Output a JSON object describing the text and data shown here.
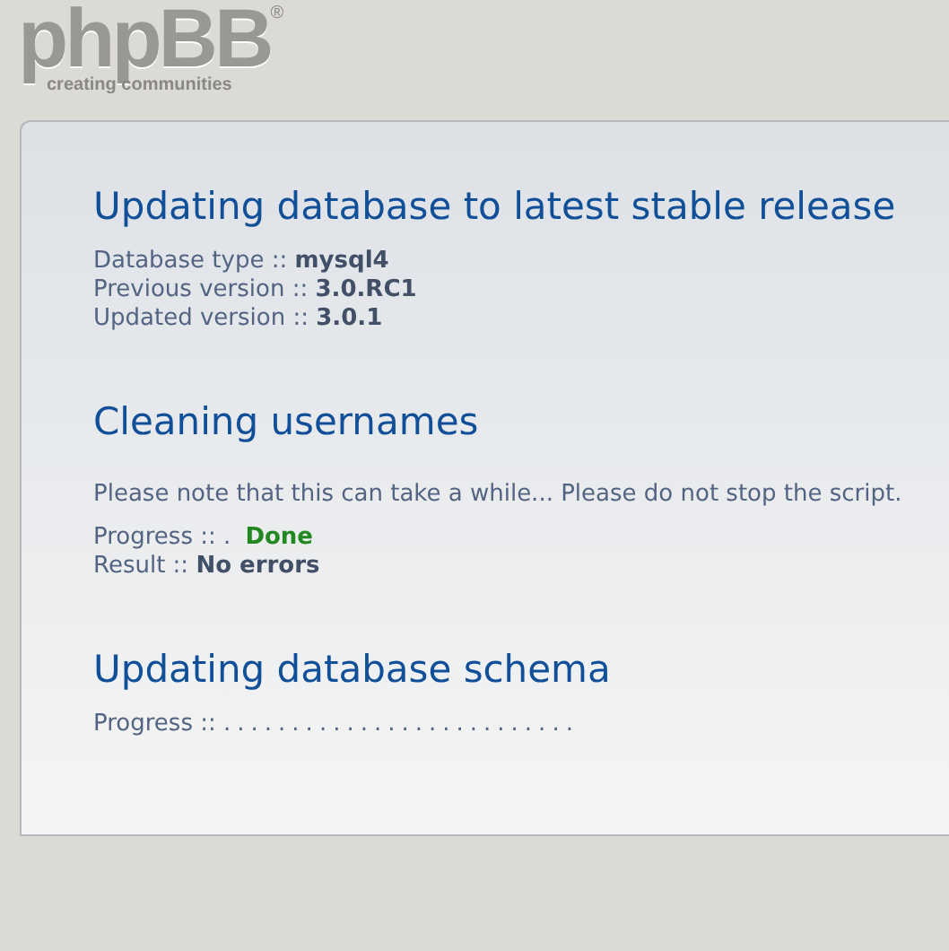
{
  "logo": {
    "name": "phpBB",
    "registered": "®",
    "tagline": "creating communities"
  },
  "sections": [
    {
      "title": "Updating database to latest stable release",
      "blocks": [
        {
          "kind": "lines",
          "lines": [
            {
              "label": "Database type ::",
              "value": "mysql4",
              "kind": "plain"
            },
            {
              "label": "Previous version ::",
              "value": "3.0.RC1",
              "kind": "plain"
            },
            {
              "label": "Updated version ::",
              "value": "3.0.1",
              "kind": "plain"
            }
          ]
        }
      ]
    },
    {
      "title": "Cleaning usernames",
      "blocks": [
        {
          "kind": "note",
          "text": "Please note that this can take a while... Please do not stop the script."
        },
        {
          "kind": "lines",
          "lines": [
            {
              "label": "Progress ::",
              "prefix": ".",
              "value": "Done",
              "kind": "success"
            },
            {
              "label": "Result ::",
              "value": "No errors",
              "kind": "plain"
            }
          ]
        }
      ]
    },
    {
      "title": "Updating database schema",
      "blocks": [
        {
          "kind": "lines",
          "lines": [
            {
              "label": "Progress ::",
              "prefix": ".........................."
            }
          ]
        }
      ]
    }
  ]
}
